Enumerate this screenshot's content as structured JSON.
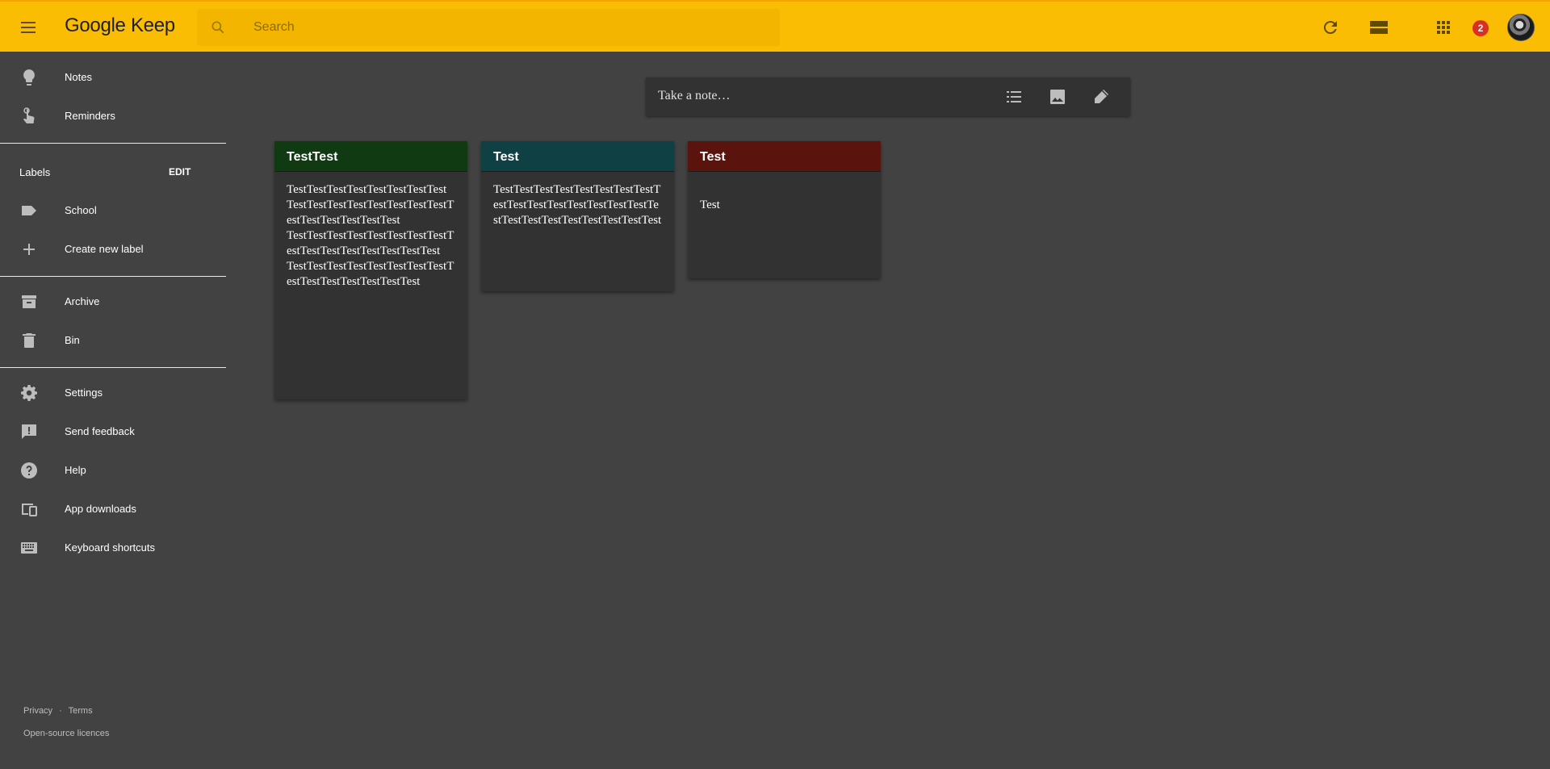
{
  "header": {
    "brand_google": "Google",
    "brand_keep": "Keep",
    "search_placeholder": "Search",
    "notification_count": "2",
    "accent_color": "#fbbc04"
  },
  "sidebar": {
    "items_top": [
      {
        "label": "Notes",
        "icon": "lightbulb-icon"
      },
      {
        "label": "Reminders",
        "icon": "reminder-hand-icon"
      }
    ],
    "labels_heading": "Labels",
    "labels_edit": "EDIT",
    "label_items": [
      {
        "label": "School",
        "icon": "label-tag-icon"
      },
      {
        "label": "Create new label",
        "icon": "plus-icon"
      }
    ],
    "items_archive": [
      {
        "label": "Archive",
        "icon": "archive-icon"
      },
      {
        "label": "Bin",
        "icon": "trash-icon"
      }
    ],
    "items_bottom": [
      {
        "label": "Settings",
        "icon": "gear-icon"
      },
      {
        "label": "Send feedback",
        "icon": "feedback-icon"
      },
      {
        "label": "Help",
        "icon": "help-icon"
      },
      {
        "label": "App downloads",
        "icon": "devices-icon"
      },
      {
        "label": "Keyboard shortcuts",
        "icon": "keyboard-icon"
      }
    ],
    "footer": {
      "privacy": "Privacy",
      "separator": "·",
      "terms": "Terms",
      "licences": "Open-source licences"
    }
  },
  "take_note": {
    "placeholder": "Take a note…",
    "icons": [
      "checklist-icon",
      "image-icon",
      "pen-icon"
    ]
  },
  "notes": [
    {
      "title": "TestTest",
      "header_color": "#0f3a12",
      "body": "TestTestTestTestTestTestTestTest\nTestTestTestTestTestTestTestTestTestTestTestTestTestTest\nTestTestTestTestTestTestTestTestTestTestTestTestTestTestTestTest\nTestTestTestTestTestTestTestTestTestTestTestTestTestTestTest"
    },
    {
      "title": "Test",
      "header_color": "#0f4044",
      "body": "TestTestTestTestTestTestTestTestTestTestTestTestTestTestTestTestTestTestTestTestTestTestTestTestTest"
    },
    {
      "title": "Test",
      "header_color": "#5b130e",
      "body": "\nTest"
    }
  ]
}
